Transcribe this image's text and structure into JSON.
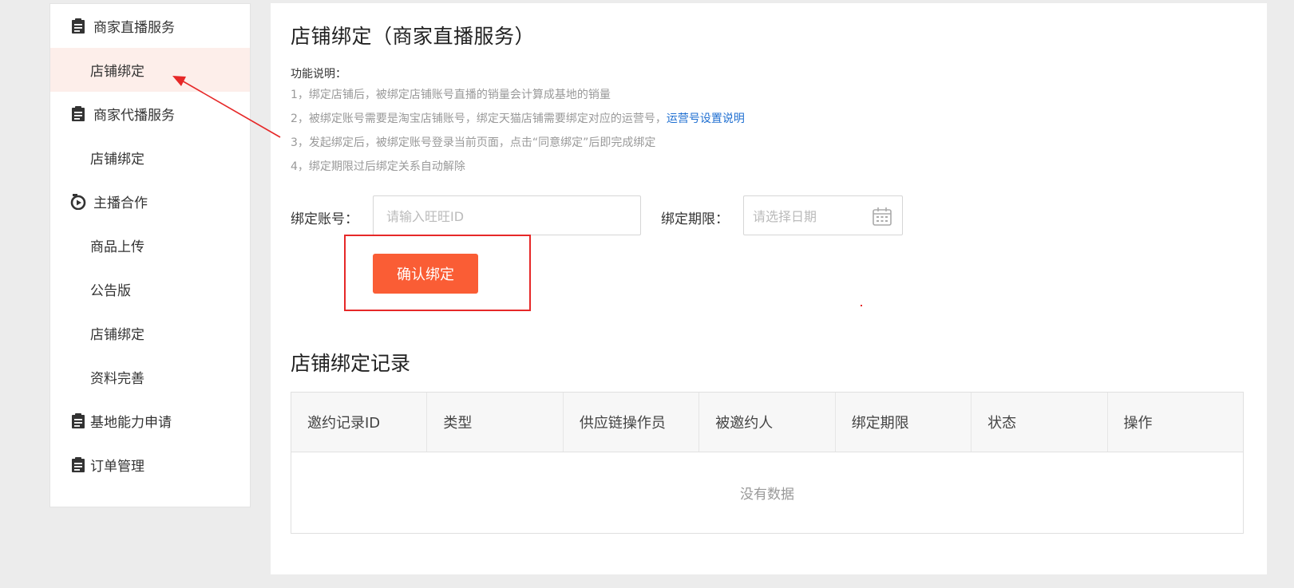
{
  "sidebar": {
    "groups": [
      {
        "label": "商家直播服务",
        "icon": "clipboard-icon",
        "items": [
          {
            "label": "店铺绑定",
            "active": true
          }
        ]
      },
      {
        "label": "商家代播服务",
        "icon": "clipboard-icon",
        "items": [
          {
            "label": "店铺绑定",
            "active": false
          }
        ]
      },
      {
        "label": "主播合作",
        "icon": "live-play-icon",
        "items": [
          {
            "label": "商品上传"
          },
          {
            "label": "公告版"
          },
          {
            "label": "店铺绑定"
          },
          {
            "label": "资料完善"
          }
        ]
      },
      {
        "label": "基地能力申请",
        "icon": "clipboard-icon",
        "items": []
      },
      {
        "label": "订单管理",
        "icon": "clipboard-icon",
        "items": []
      }
    ]
  },
  "main": {
    "title": "店铺绑定（商家直播服务）",
    "desc_title": "功能说明：",
    "desc_lines": [
      "1，绑定店铺后，被绑定店铺账号直播的销量会计算成基地的销量",
      "2，被绑定账号需要是淘宝店铺账号，绑定天猫店铺需要绑定对应的运营号，",
      "3，发起绑定后，被绑定账号登录当前页面，点击“同意绑定”后即完成绑定",
      "4，绑定期限过后绑定关系自动解除"
    ],
    "desc_link": "运营号设置说明",
    "form": {
      "account_label": "绑定账号：",
      "account_placeholder": "请输入旺旺ID",
      "period_label": "绑定期限：",
      "period_placeholder": "请选择日期",
      "confirm_label": "确认绑定"
    },
    "records": {
      "title": "店铺绑定记录",
      "columns": [
        "邀约记录ID",
        "类型",
        "供应链操作员",
        "被邀约人",
        "绑定期限",
        "状态",
        "操作"
      ],
      "empty_text": "没有数据"
    }
  },
  "colors": {
    "accent": "#fa5d35",
    "annotation": "#e62828",
    "link": "#1f6fd1",
    "active_bg": "#fdeeea"
  }
}
